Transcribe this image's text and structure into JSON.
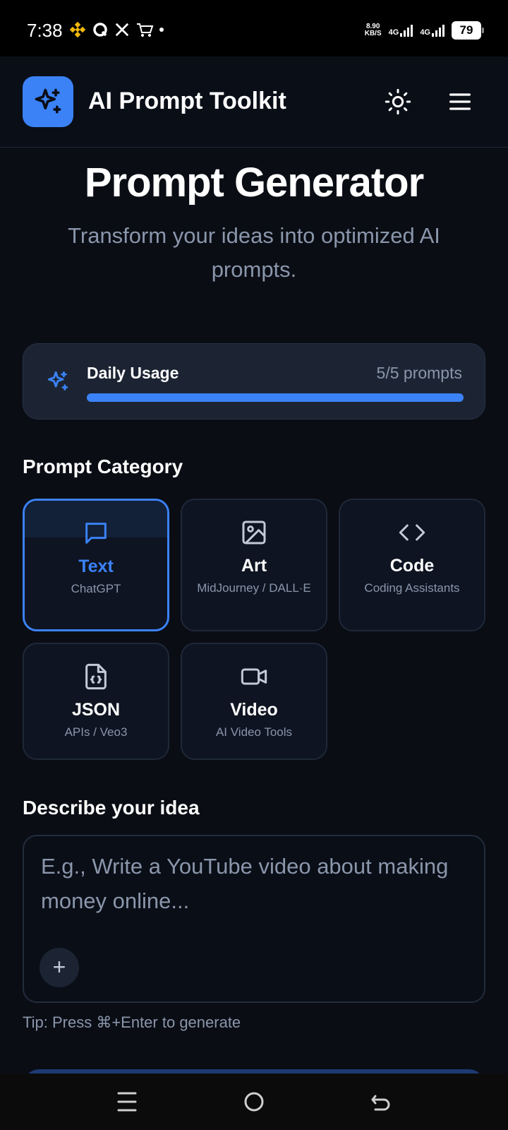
{
  "status_bar": {
    "time": "7:38",
    "net_speed_value": "8.90",
    "net_speed_unit": "KB/S",
    "signal_1": "4G",
    "signal_2": "4G",
    "battery": "79"
  },
  "header": {
    "app_title": "AI Prompt Toolkit",
    "logo_icon": "sparkles-icon",
    "theme_icon": "sun-icon",
    "menu_icon": "hamburger-menu-icon"
  },
  "hero": {
    "title": "Prompt Generator",
    "subtitle": "Transform your ideas into optimized AI prompts."
  },
  "usage": {
    "label": "Daily Usage",
    "count_text": "5/5 prompts",
    "used": 5,
    "limit": 5
  },
  "category_section": {
    "title": "Prompt Category",
    "selected": "Text",
    "categories": [
      {
        "name": "Text",
        "desc": "ChatGPT",
        "icon": "message-square-icon"
      },
      {
        "name": "Art",
        "desc": "MidJourney / DALL·E",
        "icon": "image-icon"
      },
      {
        "name": "Code",
        "desc": "Coding Assistants",
        "icon": "code-icon"
      },
      {
        "name": "JSON",
        "desc": "APIs / Veo3",
        "icon": "file-json-icon"
      },
      {
        "name": "Video",
        "desc": "AI Video Tools",
        "icon": "video-icon"
      }
    ]
  },
  "idea_section": {
    "title": "Describe your idea",
    "placeholder": "E.g., Write a YouTube video about making money online...",
    "value": "",
    "tip": "Tip: Press ⌘+Enter to generate"
  },
  "colors": {
    "accent": "#3b82f6",
    "background": "#0a0d14",
    "card": "#1c2433",
    "muted_text": "#8a96ab"
  }
}
